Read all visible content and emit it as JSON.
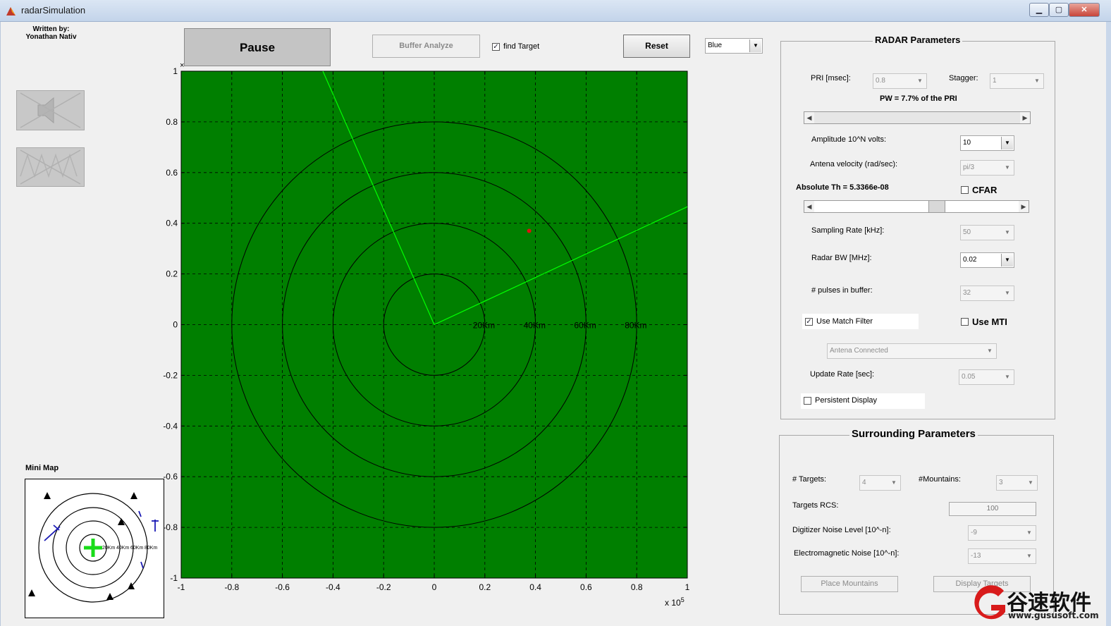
{
  "window": {
    "title": "radarSimulation",
    "minimize": "▁",
    "restore": "▢",
    "close": "✕"
  },
  "author": {
    "line1": "Written by:",
    "line2": "Yonathan Nativ"
  },
  "toolbar": {
    "pause": "Pause",
    "buffer_analyze": "Buffer Analyze",
    "find_target": "find Target",
    "find_target_checked": true,
    "reset": "Reset",
    "color": "Blue"
  },
  "minimap": {
    "label": "Mini Map",
    "ring_labels": [
      "20Km",
      "40Km",
      "60Km",
      "80Km"
    ]
  },
  "plot": {
    "ring_labels": [
      "20Km",
      "40Km",
      "60Km",
      "80Km"
    ],
    "x_ticks": [
      "-1",
      "-0.8",
      "-0.6",
      "-0.4",
      "-0.2",
      "0",
      "0.2",
      "0.4",
      "0.6",
      "0.8",
      "1"
    ],
    "y_ticks": [
      "1",
      "0.8",
      "0.6",
      "0.4",
      "0.2",
      "0",
      "-0.2",
      "-0.4",
      "-0.6",
      "-0.8",
      "-1"
    ],
    "multiplier": "x 10",
    "multiplier_exp": "5",
    "colors": {
      "background": "#007f00",
      "beam": "#00ff00",
      "target": "#e01010"
    }
  },
  "radar_params": {
    "title": "RADAR Parameters",
    "pri_label": "PRI [msec]:",
    "pri_value": "0.8",
    "stagger_label": "Stagger:",
    "stagger_value": "1",
    "pw_text": "PW = 7.7% of the PRI",
    "amplitude_label": "Amplitude 10^N volts:",
    "amplitude_value": "10",
    "antenna_velocity_label": "Antena velocity (rad/sec):",
    "antenna_velocity_value": "pi/3",
    "abs_th_text": "Absolute Th = 5.3366e-08",
    "cfar_label": "CFAR",
    "cfar_checked": false,
    "threshold_slider": 0.6,
    "sampling_rate_label": "Sampling Rate [kHz]:",
    "sampling_rate_value": "50",
    "radar_bw_label": "Radar BW [MHz]:",
    "radar_bw_value": "0.02",
    "pulses_label": "# pulses in buffer:",
    "pulses_value": "32",
    "match_filter_label": "Use Match Filter",
    "match_filter_checked": true,
    "mti_label": "Use MTI",
    "mti_checked": false,
    "antenna_mode": "Antena Connected",
    "update_rate_label": "Update Rate [sec]:",
    "update_rate_value": "0.05",
    "persistent_label": "Persistent Display",
    "persistent_checked": false
  },
  "surrounding": {
    "title": "Surrounding Parameters",
    "targets_label": "# Targets:",
    "targets_value": "4",
    "mountains_label": "#Mountains:",
    "mountains_value": "3",
    "rcs_label": "Targets RCS:",
    "rcs_value": "100",
    "digitizer_label": "Digitizer Noise Level [10^-n]:",
    "digitizer_value": "-9",
    "em_noise_label": "Electromagnetic Noise [10^-n]:",
    "em_noise_value": "-13",
    "place_mountains": "Place Mountains",
    "display_targets": "Display Targets"
  },
  "watermark": {
    "brand": "谷速软件",
    "url": "www.gususoft.com"
  }
}
